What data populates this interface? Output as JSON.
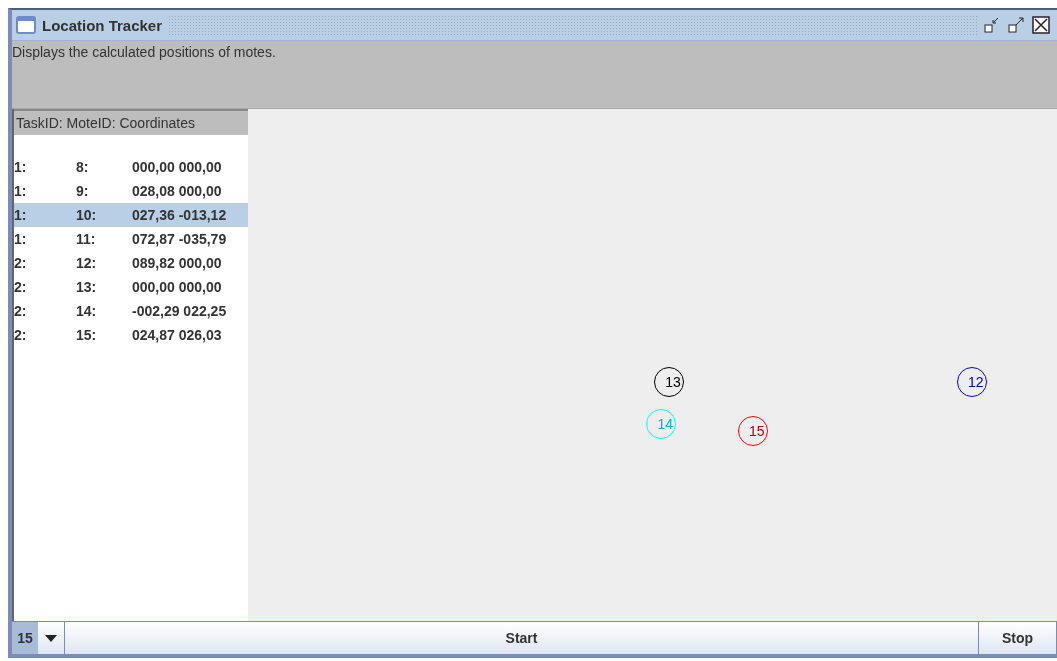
{
  "window": {
    "title": "Location Tracker"
  },
  "description": "Displays the calculated positions of motes.",
  "table": {
    "header": "TaskID: MoteID: Coordinates",
    "rows": [
      {
        "task": "1:",
        "mote": "8:",
        "coords": "000,00 000,00",
        "selected": false
      },
      {
        "task": "1:",
        "mote": "9:",
        "coords": "028,08 000,00",
        "selected": false
      },
      {
        "task": "1:",
        "mote": "10:",
        "coords": "027,36 -013,12",
        "selected": true
      },
      {
        "task": "1:",
        "mote": "11:",
        "coords": "072,87 -035,79",
        "selected": false
      },
      {
        "task": "2:",
        "mote": "12:",
        "coords": "089,82 000,00",
        "selected": false,
        "marker": {
          "label": "12",
          "color": "#0000ff"
        }
      },
      {
        "task": "2:",
        "mote": "13:",
        "coords": "000,00 000,00",
        "selected": false,
        "marker": {
          "label": "13",
          "color": "#000000"
        }
      },
      {
        "task": "2:",
        "mote": "14:",
        "coords": "-002,29 022,25",
        "selected": false,
        "marker": {
          "label": "14",
          "color": "#00ffff"
        }
      },
      {
        "task": "2:",
        "mote": "15:",
        "coords": "024,87 026,03",
        "selected": false,
        "marker": {
          "label": "15",
          "color": "#ff0000"
        }
      }
    ]
  },
  "controls": {
    "combo_value": "15",
    "start": "Start",
    "stop": "Stop"
  }
}
